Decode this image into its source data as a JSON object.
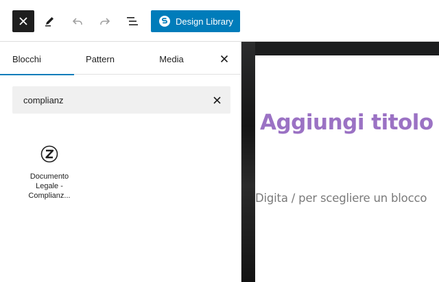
{
  "toolbar": {
    "close_icon": "close-icon",
    "edit_icon": "pencil-icon",
    "undo_icon": "undo-icon",
    "redo_icon": "redo-icon",
    "outline_icon": "list-view-icon",
    "design_library_label": "Design Library",
    "design_library_icon": "stackable-logo-icon",
    "accent": "#007cba"
  },
  "inserter": {
    "tabs": [
      {
        "label": "Blocchi",
        "active": true
      },
      {
        "label": "Pattern",
        "active": false
      },
      {
        "label": "Media",
        "active": false
      }
    ],
    "search": {
      "value": "complianz",
      "placeholder": ""
    },
    "results": [
      {
        "title": "Documento Legale - Complianz...",
        "icon": "complianz-logo-icon"
      }
    ]
  },
  "editor": {
    "title_placeholder": "Aggiungi titolo",
    "title_color": "#9b72c4",
    "block_placeholder": "Digita / per scegliere un blocco"
  }
}
